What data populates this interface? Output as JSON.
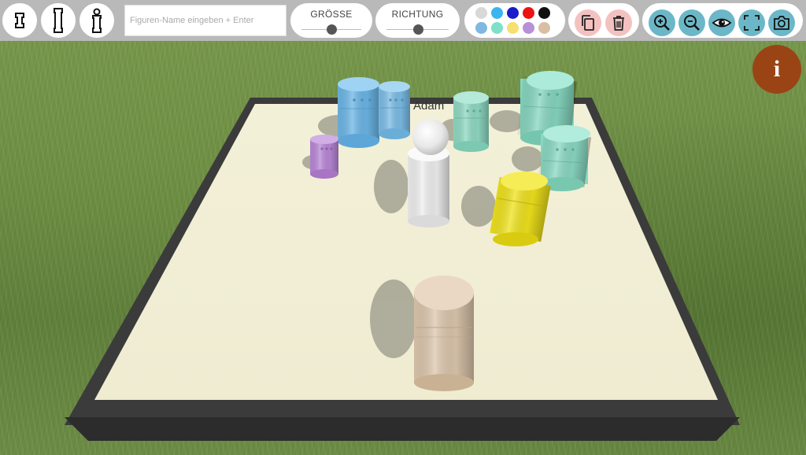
{
  "toolbar": {
    "figure_buttons": [
      "figure-small-icon",
      "figure-tall-icon",
      "figure-person-icon"
    ],
    "name_input": {
      "placeholder": "Figuren-Name eingeben + Enter",
      "value": ""
    },
    "size_slider": {
      "label": "GRÖSSE",
      "value": 0.5
    },
    "direction_slider": {
      "label": "RICHTUNG",
      "value": 0.5
    },
    "colors": {
      "row1": [
        "#d8d8d8",
        "#3ab5ef",
        "#1a1acc",
        "#ee1111",
        "#111111"
      ],
      "row2": [
        "#7fb8e0",
        "#7ee0c8",
        "#f5e070",
        "#b890d8",
        "#d8bfa3"
      ]
    },
    "edit_actions": [
      "copy-icon",
      "trash-icon"
    ],
    "view_actions": [
      "zoom-in-icon",
      "zoom-out-icon",
      "eye-icon",
      "fullscreen-icon",
      "camera-icon"
    ]
  },
  "info_button": {
    "label": "i",
    "color": "#9a4415"
  },
  "scene": {
    "figure_label": "Adam",
    "figures": [
      {
        "name": "tall-blue-1",
        "color": "#6cb6e6"
      },
      {
        "name": "tall-blue-2",
        "color": "#7cbde6"
      },
      {
        "name": "small-purple",
        "color": "#b987d6"
      },
      {
        "name": "adam",
        "color": "#eeeeee"
      },
      {
        "name": "mint-1",
        "color": "#8fd9c3"
      },
      {
        "name": "mint-2",
        "color": "#86d6bf"
      },
      {
        "name": "mint-3",
        "color": "#8ad8c2"
      },
      {
        "name": "yellow",
        "color": "#efe21c"
      },
      {
        "name": "beige",
        "color": "#dcc6ac"
      }
    ]
  }
}
